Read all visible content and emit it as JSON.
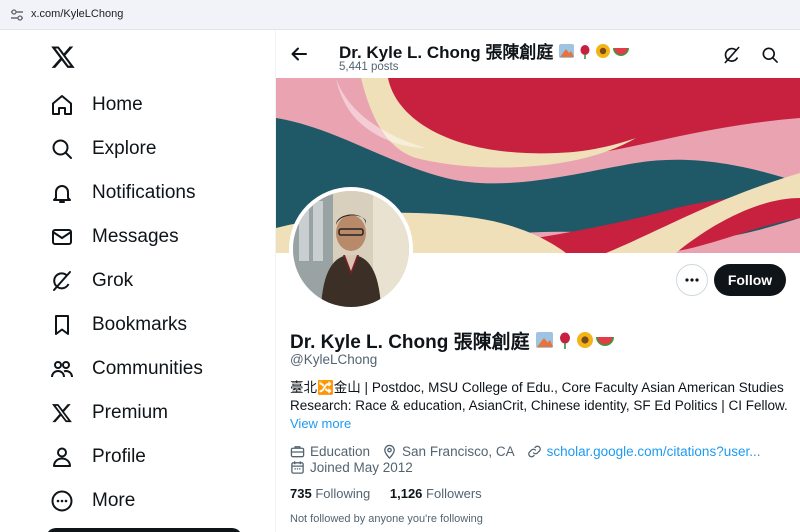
{
  "browser": {
    "url": "x.com/KyleLChong"
  },
  "sidebar": {
    "items": [
      {
        "label": "Home",
        "icon": "home-icon"
      },
      {
        "label": "Explore",
        "icon": "search-icon"
      },
      {
        "label": "Notifications",
        "icon": "bell-icon"
      },
      {
        "label": "Messages",
        "icon": "envelope-icon"
      },
      {
        "label": "Grok",
        "icon": "grok-icon"
      },
      {
        "label": "Bookmarks",
        "icon": "bookmark-icon"
      },
      {
        "label": "Communities",
        "icon": "people-icon"
      },
      {
        "label": "Premium",
        "icon": "x-logo-icon"
      },
      {
        "label": "Profile",
        "icon": "person-icon"
      },
      {
        "label": "More",
        "icon": "more-circle-icon"
      }
    ]
  },
  "header": {
    "name": "Dr. Kyle L. Chong 張陳創庭",
    "posts": "5,441 posts"
  },
  "profile": {
    "name": "Dr. Kyle L. Chong 張陳創庭",
    "handle": "@KyleLChong",
    "bio_line1": "臺北🔀金山 | Postdoc, MSU College of Edu., Core Faculty Asian American Studies",
    "bio_line2": "Research: Race & education, AsianCrit, Chinese identity, SF Ed Politics | CI Fellow.",
    "view_more": "View more",
    "category": "Education",
    "location": "San Francisco, CA",
    "website": "scholar.google.com/citations?user...",
    "joined": "Joined May 2012",
    "following_count": "735",
    "following_label": "Following",
    "followers_count": "1,126",
    "followers_label": "Followers",
    "not_followed": "Not followed by anyone you're following",
    "follow_label": "Follow"
  },
  "colors": {
    "accent": "#1d9bf0",
    "text": "#0f1419",
    "muted": "#536471",
    "banner_crimson": "#c8203f",
    "banner_teal": "#1f5866",
    "banner_pink": "#e9a3b1",
    "banner_cream": "#efe0b9"
  }
}
